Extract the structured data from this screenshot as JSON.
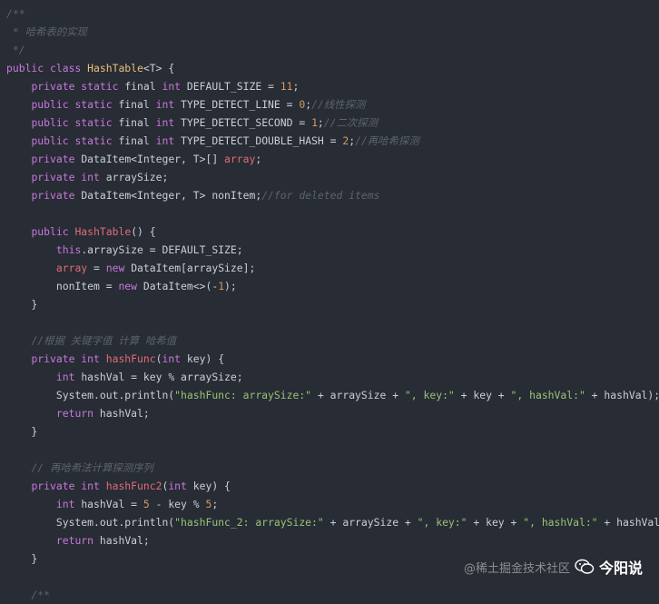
{
  "colors": {
    "background": "#282c34",
    "comment": "#5c6370",
    "keyword": "#c678dd",
    "plain": "#c9cfd8",
    "class": "#e5c07b",
    "function": "#e06c75",
    "number": "#d19a66",
    "string": "#98c379"
  },
  "code_lines": [
    [
      [
        "comment",
        "/**"
      ]
    ],
    [
      [
        "comment",
        " * 哈希表的实现"
      ]
    ],
    [
      [
        "comment",
        " */"
      ]
    ],
    [
      [
        "keyword",
        "public class "
      ],
      [
        "class",
        "HashTable"
      ],
      [
        "plain",
        "<T> {"
      ]
    ],
    [
      [
        "plain",
        "    "
      ],
      [
        "keyword",
        "private static "
      ],
      [
        "plain",
        "final "
      ],
      [
        "keyword",
        "int "
      ],
      [
        "plain",
        "DEFAULT_SIZE = "
      ],
      [
        "number",
        "11"
      ],
      [
        "plain",
        ";"
      ]
    ],
    [
      [
        "plain",
        "    "
      ],
      [
        "keyword",
        "public static "
      ],
      [
        "plain",
        "final "
      ],
      [
        "keyword",
        "int "
      ],
      [
        "plain",
        "TYPE_DETECT_LINE = "
      ],
      [
        "number",
        "0"
      ],
      [
        "plain",
        ";"
      ],
      [
        "comment",
        "//线性探测"
      ]
    ],
    [
      [
        "plain",
        "    "
      ],
      [
        "keyword",
        "public static "
      ],
      [
        "plain",
        "final "
      ],
      [
        "keyword",
        "int "
      ],
      [
        "plain",
        "TYPE_DETECT_SECOND = "
      ],
      [
        "number",
        "1"
      ],
      [
        "plain",
        ";"
      ],
      [
        "comment",
        "//二次探测"
      ]
    ],
    [
      [
        "plain",
        "    "
      ],
      [
        "keyword",
        "public static "
      ],
      [
        "plain",
        "final "
      ],
      [
        "keyword",
        "int "
      ],
      [
        "plain",
        "TYPE_DETECT_DOUBLE_HASH = "
      ],
      [
        "number",
        "2"
      ],
      [
        "plain",
        ";"
      ],
      [
        "comment",
        "//再哈希探测"
      ]
    ],
    [
      [
        "plain",
        "    "
      ],
      [
        "keyword",
        "private "
      ],
      [
        "plain",
        "DataItem<Integer, T>[] "
      ],
      [
        "field",
        "array"
      ],
      [
        "plain",
        ";"
      ]
    ],
    [
      [
        "plain",
        "    "
      ],
      [
        "keyword",
        "private int "
      ],
      [
        "plain",
        "arraySize;"
      ]
    ],
    [
      [
        "plain",
        "    "
      ],
      [
        "keyword",
        "private "
      ],
      [
        "plain",
        "DataItem<Integer, T> nonItem;"
      ],
      [
        "comment",
        "//for deleted items"
      ]
    ],
    [
      [
        "plain",
        ""
      ]
    ],
    [
      [
        "plain",
        "    "
      ],
      [
        "keyword",
        "public "
      ],
      [
        "fn",
        "HashTable"
      ],
      [
        "plain",
        "() {"
      ]
    ],
    [
      [
        "plain",
        "        "
      ],
      [
        "keyword",
        "this"
      ],
      [
        "plain",
        ".arraySize = DEFAULT_SIZE;"
      ]
    ],
    [
      [
        "plain",
        "        "
      ],
      [
        "field",
        "array"
      ],
      [
        "plain",
        " = "
      ],
      [
        "keyword",
        "new "
      ],
      [
        "plain",
        "DataItem[arraySize];"
      ]
    ],
    [
      [
        "plain",
        "        nonItem = "
      ],
      [
        "keyword",
        "new "
      ],
      [
        "plain",
        "DataItem<>(-"
      ],
      [
        "number",
        "1"
      ],
      [
        "plain",
        ");"
      ]
    ],
    [
      [
        "plain",
        "    }"
      ]
    ],
    [
      [
        "plain",
        ""
      ]
    ],
    [
      [
        "plain",
        "    "
      ],
      [
        "comment",
        "//根据 关键字值 计算 哈希值"
      ]
    ],
    [
      [
        "plain",
        "    "
      ],
      [
        "keyword",
        "private int "
      ],
      [
        "fn",
        "hashFunc"
      ],
      [
        "plain",
        "("
      ],
      [
        "keyword",
        "int "
      ],
      [
        "plain",
        "key) {"
      ]
    ],
    [
      [
        "plain",
        "        "
      ],
      [
        "keyword",
        "int "
      ],
      [
        "plain",
        "hashVal = key % arraySize;"
      ]
    ],
    [
      [
        "plain",
        "        System.out.println("
      ],
      [
        "string",
        "\"hashFunc: arraySize:\""
      ],
      [
        "plain",
        " + arraySize + "
      ],
      [
        "string",
        "\", key:\""
      ],
      [
        "plain",
        " + key + "
      ],
      [
        "string",
        "\", hashVal:\""
      ],
      [
        "plain",
        " + hashVal);"
      ]
    ],
    [
      [
        "plain",
        "        "
      ],
      [
        "keyword",
        "return "
      ],
      [
        "plain",
        "hashVal;"
      ]
    ],
    [
      [
        "plain",
        "    }"
      ]
    ],
    [
      [
        "plain",
        ""
      ]
    ],
    [
      [
        "plain",
        "    "
      ],
      [
        "comment",
        "// 再哈希法计算探测序列"
      ]
    ],
    [
      [
        "plain",
        "    "
      ],
      [
        "keyword",
        "private int "
      ],
      [
        "fn",
        "hashFunc2"
      ],
      [
        "plain",
        "("
      ],
      [
        "keyword",
        "int "
      ],
      [
        "plain",
        "key) {"
      ]
    ],
    [
      [
        "plain",
        "        "
      ],
      [
        "keyword",
        "int "
      ],
      [
        "plain",
        "hashVal = "
      ],
      [
        "number",
        "5"
      ],
      [
        "plain",
        " - key % "
      ],
      [
        "number",
        "5"
      ],
      [
        "plain",
        ";"
      ]
    ],
    [
      [
        "plain",
        "        System.out.println("
      ],
      [
        "string",
        "\"hashFunc_2: arraySize:\""
      ],
      [
        "plain",
        " + arraySize + "
      ],
      [
        "string",
        "\", key:\""
      ],
      [
        "plain",
        " + key + "
      ],
      [
        "string",
        "\", hashVal:\""
      ],
      [
        "plain",
        " + hashVal);"
      ]
    ],
    [
      [
        "plain",
        "        "
      ],
      [
        "keyword",
        "return "
      ],
      [
        "plain",
        "hashVal;"
      ]
    ],
    [
      [
        "plain",
        "    }"
      ]
    ],
    [
      [
        "plain",
        ""
      ]
    ],
    [
      [
        "comment",
        "    /**"
      ]
    ]
  ],
  "watermark": {
    "handle": "@稀土掘金技术社区",
    "brand": "今阳说",
    "icon": "wechat-icon"
  }
}
